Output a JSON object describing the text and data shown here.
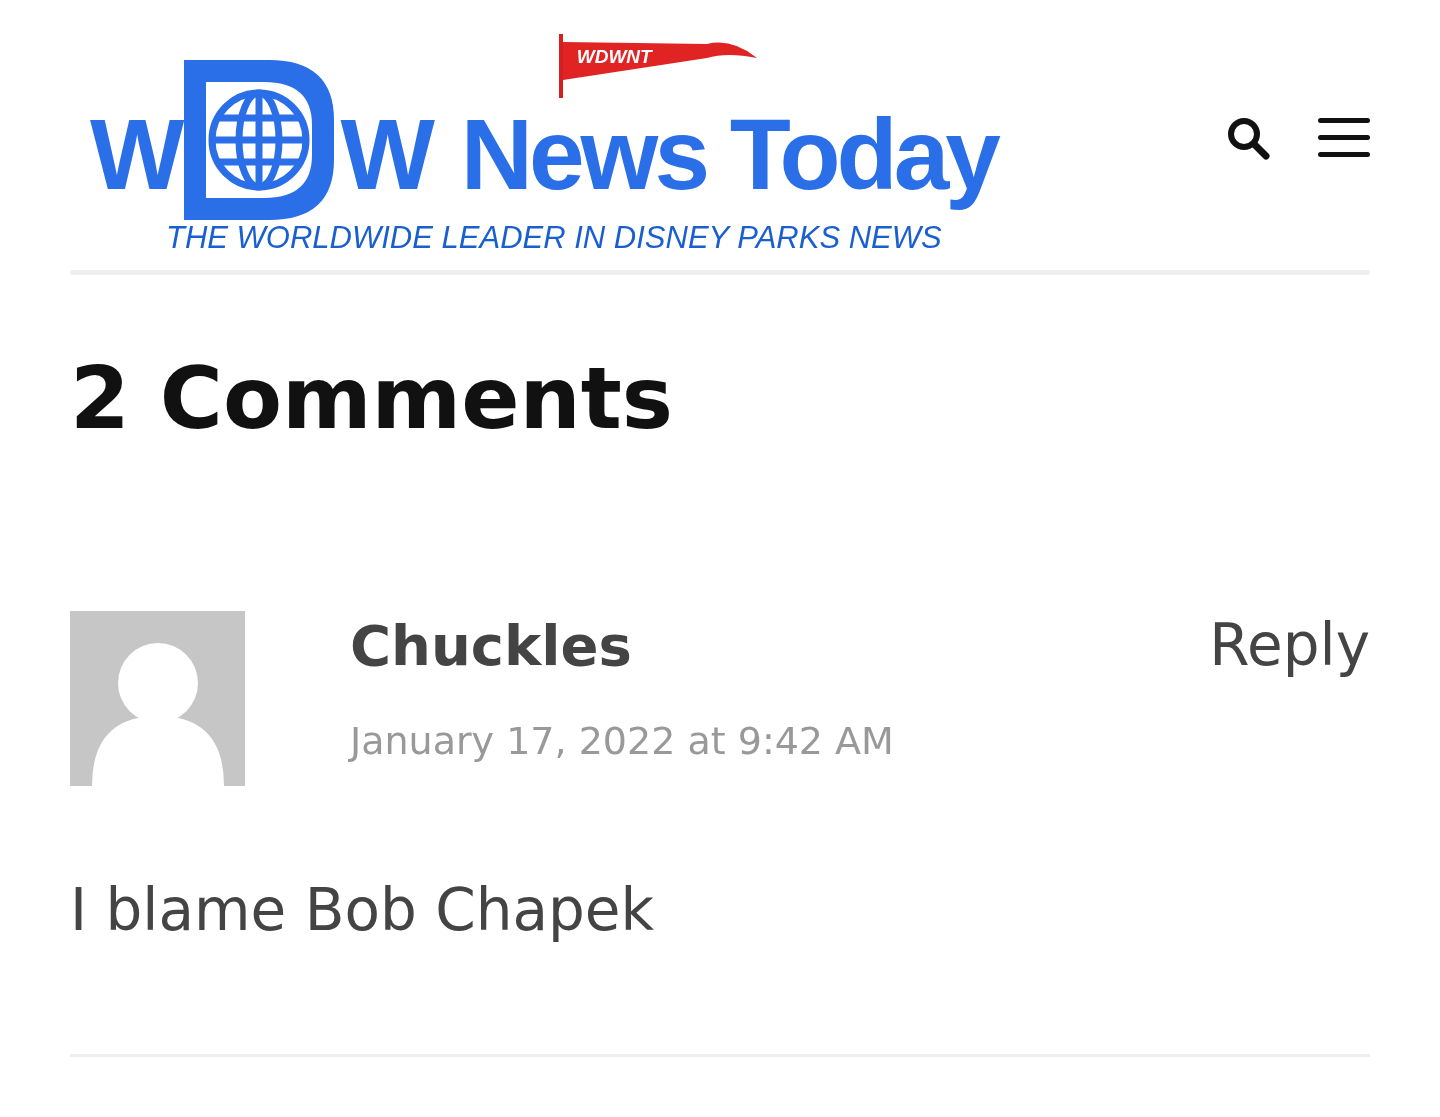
{
  "logo": {
    "left_letter": "W",
    "right_letter": "W",
    "title": "News Today",
    "flag": "WDWNT",
    "tagline": "THE WORLDWIDE LEADER IN DISNEY PARKS NEWS"
  },
  "heading": "2 Comments",
  "comments": [
    {
      "author": "Chuckles",
      "reply": "Reply",
      "date": "January 17, 2022 at 9:42 AM",
      "body": "I blame Bob Chapek"
    }
  ]
}
